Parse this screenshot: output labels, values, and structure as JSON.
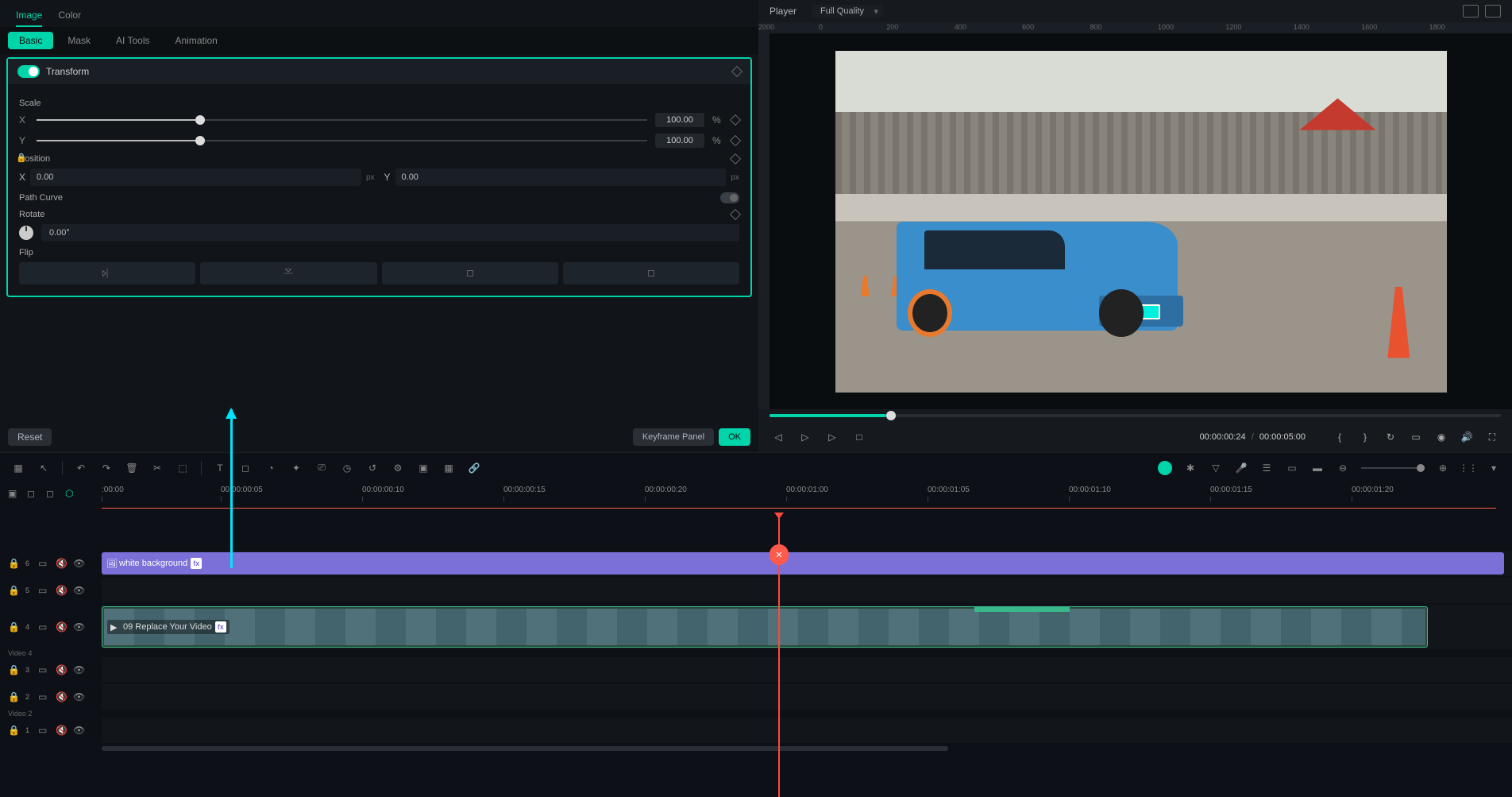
{
  "panel": {
    "tabs": {
      "image": "Image",
      "color": "Color"
    },
    "subtabs": {
      "basic": "Basic",
      "mask": "Mask",
      "ai": "AI Tools",
      "anim": "Animation"
    }
  },
  "transform": {
    "title": "Transform",
    "scale_label": "Scale",
    "x": "X",
    "y": "Y",
    "scale_x": "100.00",
    "scale_y": "100.00",
    "pct": "%",
    "position_label": "Position",
    "pos_x": "0.00",
    "pos_y": "0.00",
    "px": "px",
    "path_label": "Path Curve",
    "rotate_label": "Rotate",
    "rotate_val": "0.00°",
    "flip_label": "Flip"
  },
  "footer": {
    "reset": "Reset",
    "keyframe": "Keyframe Panel",
    "ok": "OK"
  },
  "player": {
    "title": "Player",
    "quality": "Full Quality",
    "ruler_marks": [
      "0",
      "200",
      "400",
      "600",
      "800",
      "1000",
      "1200",
      "1400",
      "1600",
      "1800",
      "2000"
    ],
    "current": "00:00:00:24",
    "total": "00:00:05:00"
  },
  "timeline": {
    "ruler": [
      ":00:00",
      "00:00:00:05",
      "00:00:00:10",
      "00:00:00:15",
      "00:00:00:20",
      "00:00:01:00",
      "00:00:01:05",
      "00:00:01:10",
      "00:00:01:15",
      "00:00:01:20"
    ],
    "tracks": {
      "t6": "6",
      "t5": "5",
      "t4": "4",
      "t3": "3",
      "t2": "2",
      "t1": "1",
      "video4": "Video 4",
      "video2": "Video 2"
    },
    "clip_bg": "white background",
    "clip_video": "09 Replace Your Video",
    "marker": "✕"
  }
}
